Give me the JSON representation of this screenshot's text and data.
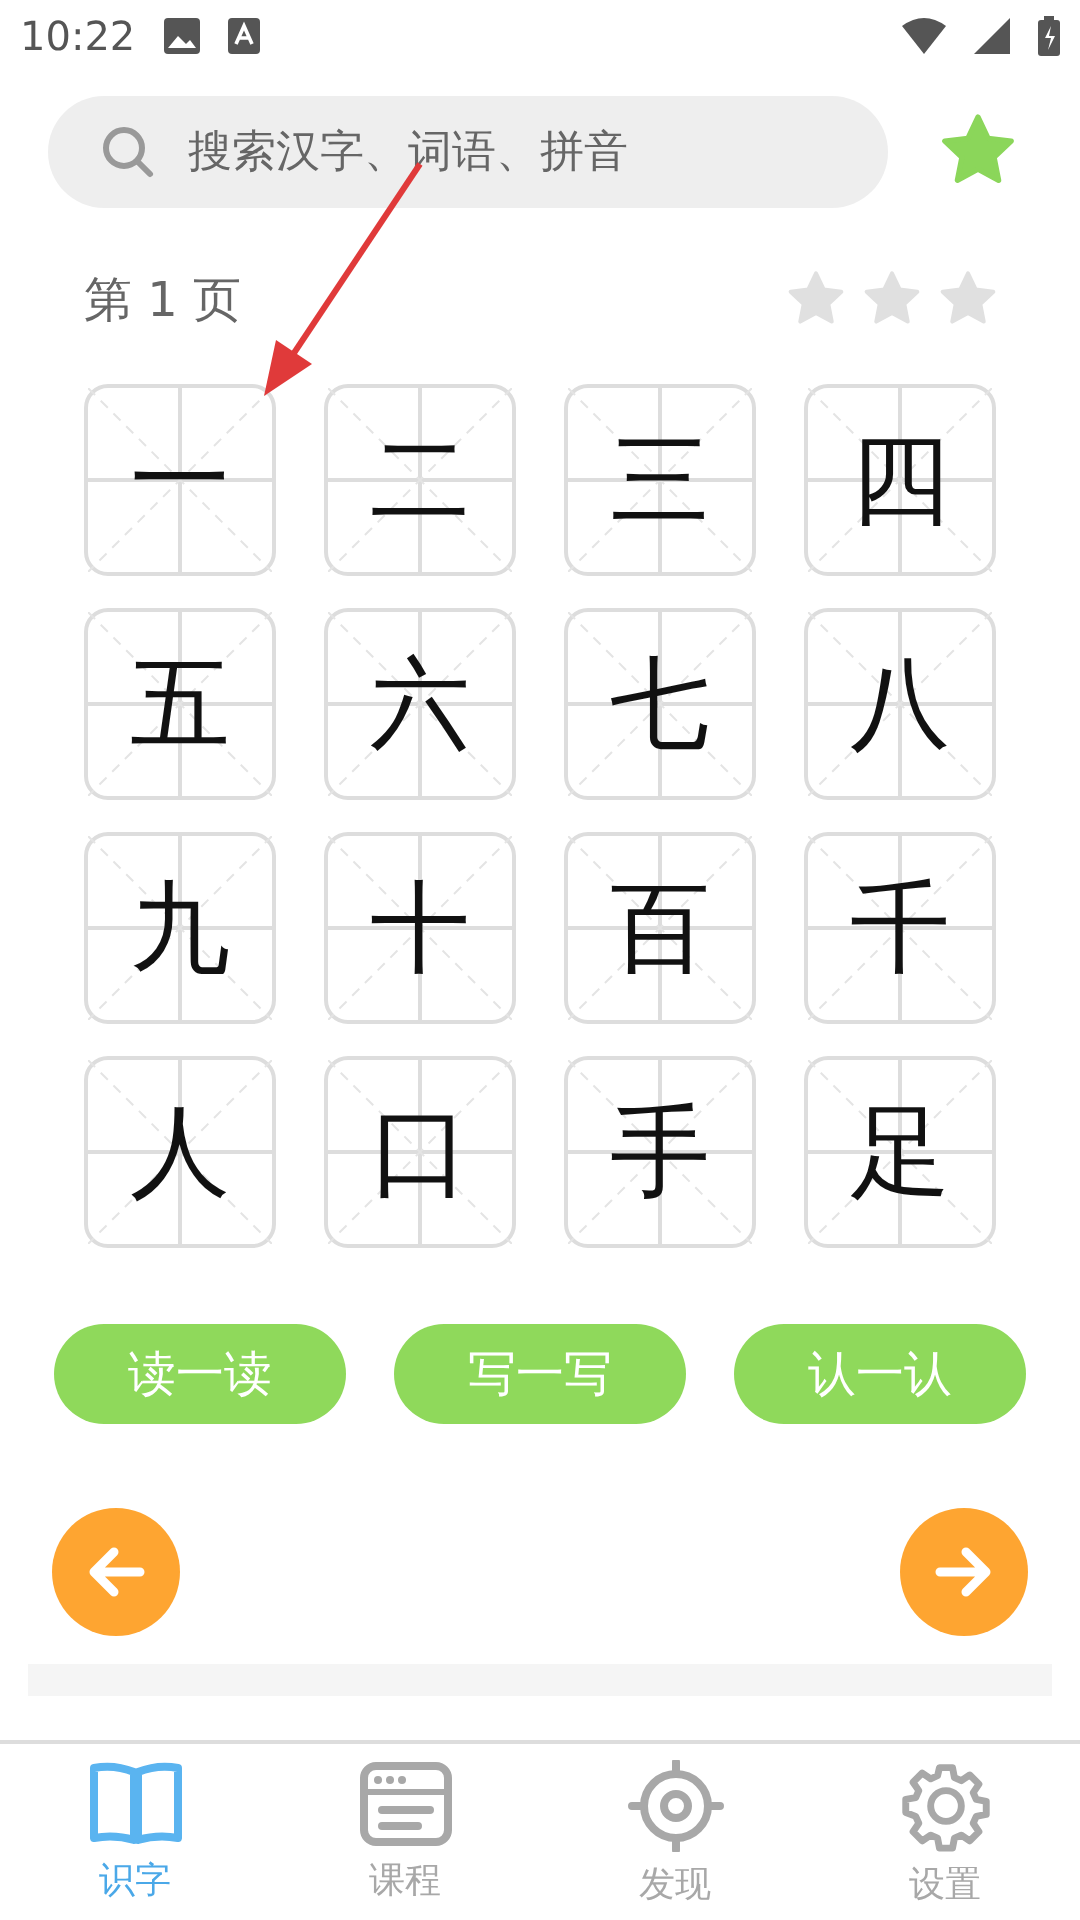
{
  "status_bar": {
    "time": "10:22"
  },
  "search": {
    "placeholder": "搜索汉字、词语、拼音"
  },
  "page": {
    "label": "第 1 页",
    "stars": 0
  },
  "characters": [
    "一",
    "二",
    "三",
    "四",
    "五",
    "六",
    "七",
    "八",
    "九",
    "十",
    "百",
    "千",
    "人",
    "口",
    "手",
    "足"
  ],
  "actions": [
    "读一读",
    "写一写",
    "认一认"
  ],
  "nav": [
    {
      "label": "识字",
      "selected": true
    },
    {
      "label": "课程",
      "selected": false
    },
    {
      "label": "发现",
      "selected": false
    },
    {
      "label": "设置",
      "selected": false
    }
  ]
}
